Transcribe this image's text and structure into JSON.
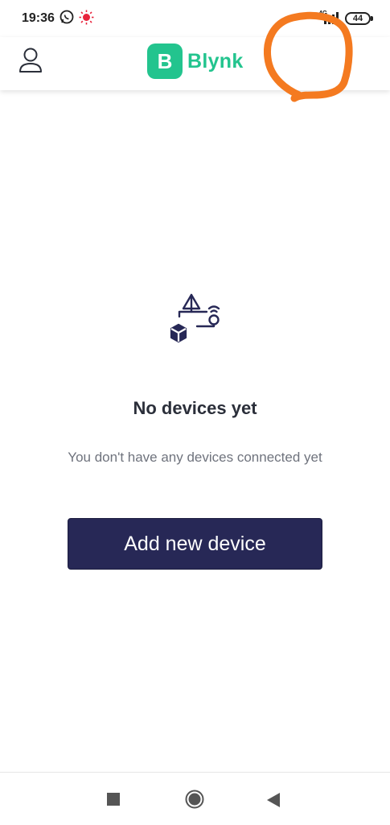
{
  "status_bar": {
    "time": "19:36",
    "battery": "44",
    "network_type": "4G",
    "icons": [
      "whatsapp-icon",
      "alert-sun-icon",
      "signal-icon",
      "battery-icon"
    ]
  },
  "header": {
    "brand_letter": "B",
    "brand_name": "Blynk",
    "brand_color": "#23c48e",
    "left_icon": "profile-icon"
  },
  "empty_state": {
    "icon": "devices-illustration-icon",
    "title": "No devices yet",
    "subtitle": "You don't have any devices connected yet",
    "button_label": "Add new device",
    "button_color": "#272856"
  },
  "annotation": {
    "color": "#f47a20",
    "shape": "freehand-circle"
  },
  "nav_bar": {
    "buttons": [
      "recents-square-icon",
      "home-circle-icon",
      "back-triangle-icon"
    ]
  }
}
